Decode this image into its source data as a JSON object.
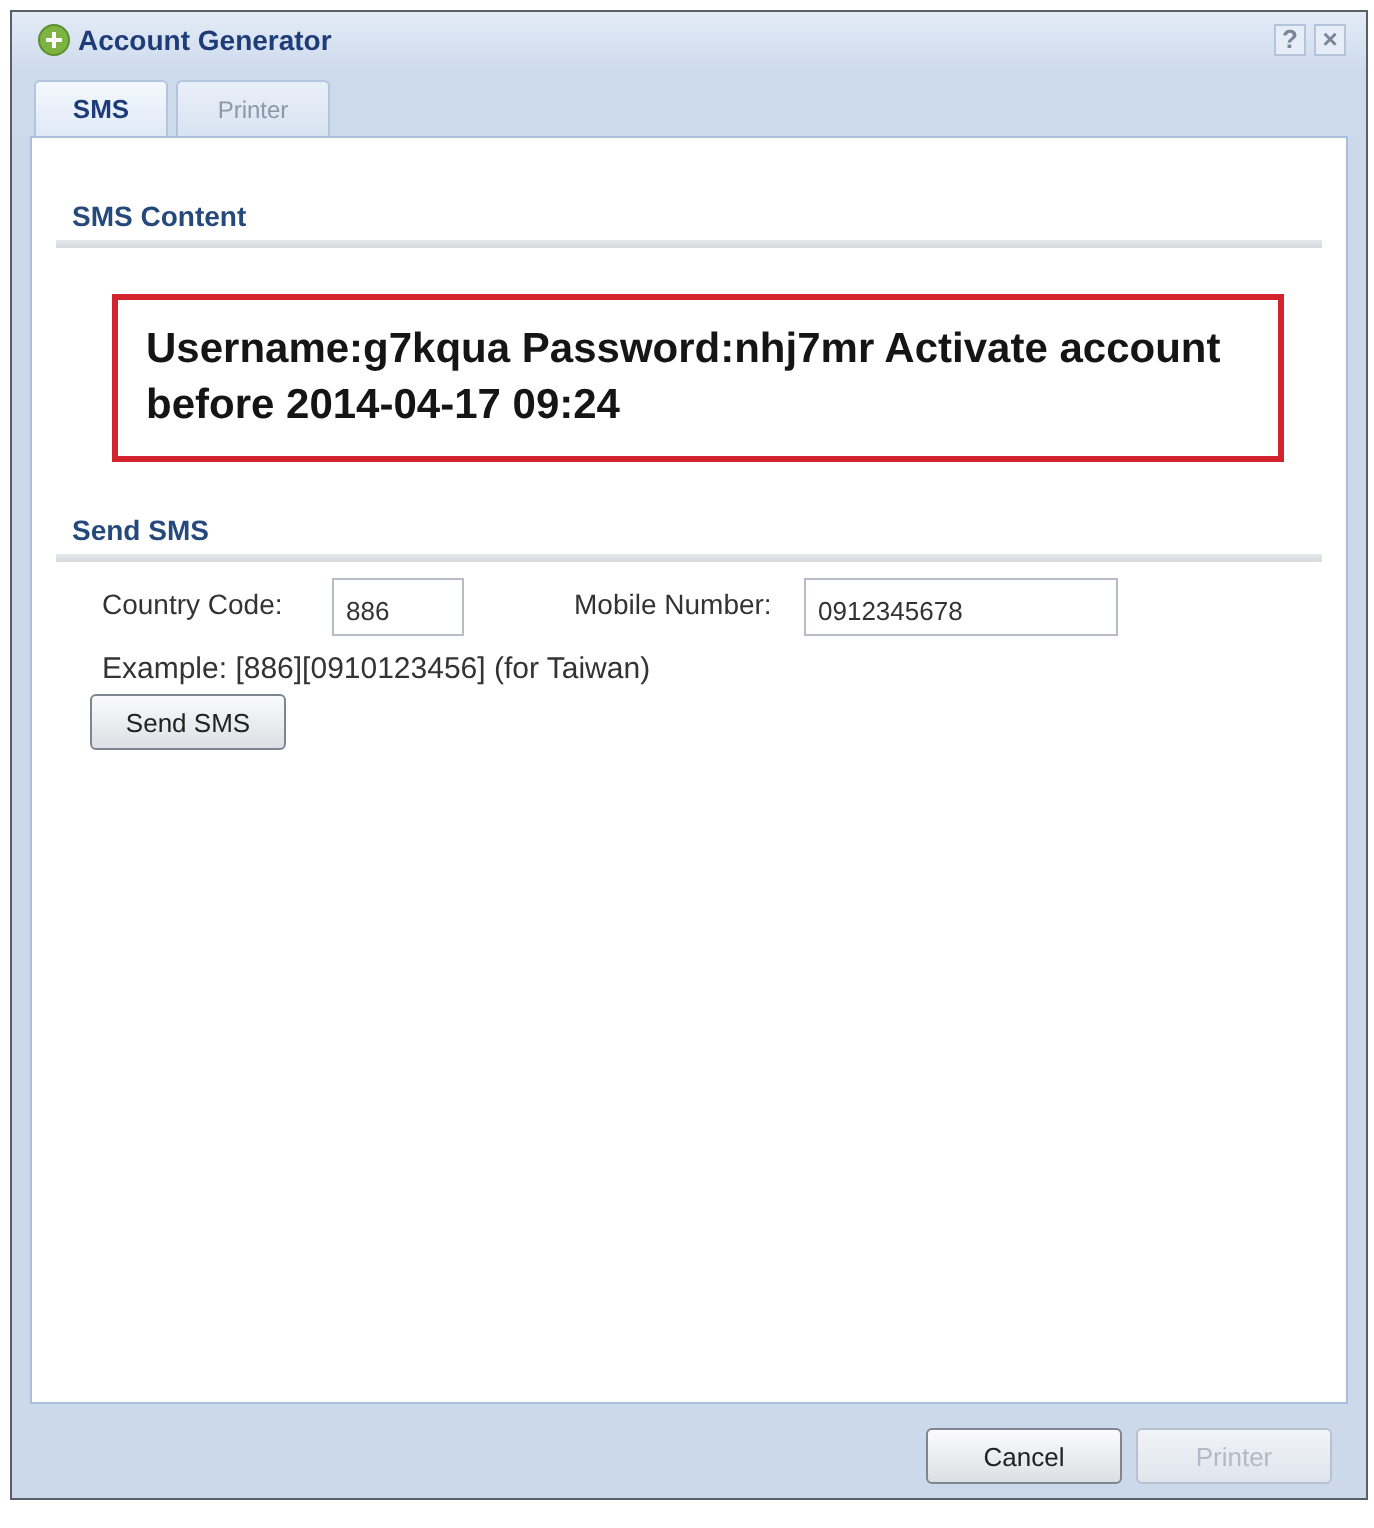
{
  "window": {
    "title": "Account Generator",
    "title_buttons": [
      "?",
      "×"
    ]
  },
  "tabs": [
    {
      "label": "SMS",
      "selected": true
    },
    {
      "label": "Printer",
      "selected": false
    }
  ],
  "sms_content": {
    "heading": "SMS Content",
    "message": "Username:g7kqua Password:nhj7mr Activate account before 2014-04-17 09:24"
  },
  "send_sms": {
    "heading": "Send SMS",
    "fields": [
      {
        "label": "Country Code:",
        "value": "886"
      },
      {
        "label": "Mobile Number:",
        "value": "0912345678"
      }
    ],
    "example": "Example: [886][0910123456] (for Taiwan)",
    "button": "Send SMS"
  },
  "footer_buttons": [
    {
      "label": "Cancel",
      "disabled": false
    },
    {
      "label": "Printer",
      "disabled": true
    }
  ]
}
